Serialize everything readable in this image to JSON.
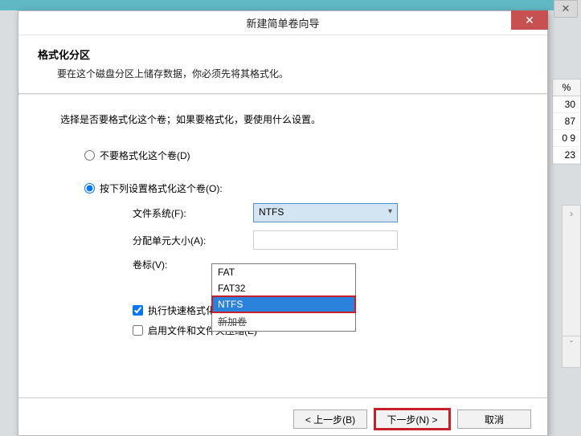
{
  "window": {
    "title": "新建简单卷向导"
  },
  "header": {
    "title": "格式化分区",
    "desc": "要在这个磁盘分区上储存数据，你必须先将其格式化。"
  },
  "content": {
    "intro": "选择是否要格式化这个卷；如果要格式化，要使用什么设置。",
    "radio_noformat": "不要格式化这个卷(D)",
    "radio_format": "按下列设置格式化这个卷(O):",
    "label_fs": "文件系统(F):",
    "label_alloc": "分配单元大小(A):",
    "label_vol": "卷标(V):",
    "fs_selected": "NTFS",
    "fs_options": {
      "fat": "FAT",
      "fat32": "FAT32",
      "ntfs": "NTFS"
    },
    "alloc_value": "",
    "vol_struck": "新加卷",
    "check_quick": "执行快速格式化(P)",
    "check_compress": "启用文件和文件夹压缩(E)"
  },
  "footer": {
    "back": "< 上一步(B)",
    "next": "下一步(N) >",
    "cancel": "取消"
  },
  "bg": {
    "col_header": "%",
    "rows": [
      "30",
      "87",
      "0 9",
      "23"
    ]
  }
}
